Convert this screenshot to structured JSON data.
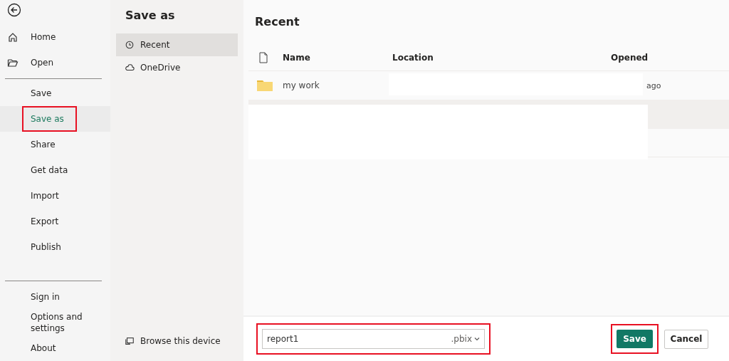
{
  "nav": {
    "groups": [
      {
        "items": [
          {
            "label": "Home",
            "kind": "home",
            "selected": false,
            "highlighted": false
          },
          {
            "label": "Open",
            "kind": "open",
            "selected": false,
            "highlighted": false
          }
        ]
      },
      {
        "items": [
          {
            "label": "Save",
            "selected": false,
            "highlighted": false
          },
          {
            "label": "Save as",
            "selected": true,
            "highlighted": true
          },
          {
            "label": "Share",
            "selected": false,
            "highlighted": false
          },
          {
            "label": "Get data",
            "selected": false,
            "highlighted": false
          },
          {
            "label": "Import",
            "selected": false,
            "highlighted": false
          },
          {
            "label": "Export",
            "selected": false,
            "highlighted": false
          },
          {
            "label": "Publish",
            "selected": false,
            "highlighted": false
          }
        ]
      },
      {
        "items": [
          {
            "label": "Sign in",
            "selected": false,
            "highlighted": false
          },
          {
            "label": "Options and settings",
            "selected": false,
            "highlighted": false
          },
          {
            "label": "About",
            "selected": false,
            "highlighted": false
          }
        ]
      }
    ]
  },
  "places": {
    "title": "Save as",
    "items": [
      {
        "label": "Recent",
        "kind": "recent",
        "selected": true
      },
      {
        "label": "OneDrive",
        "kind": "onedrive",
        "selected": false
      }
    ],
    "browse": "Browse this device"
  },
  "recent": {
    "title": "Recent",
    "columns": [
      "Name",
      "Location",
      "Opened"
    ],
    "rows": [
      {
        "name": "my work",
        "opened": "ago"
      }
    ]
  },
  "footer": {
    "filename": {
      "value": "report1",
      "extension": ".pbix",
      "highlighted": true
    },
    "save": {
      "label": "Save",
      "highlighted": true
    },
    "cancel": {
      "label": "Cancel"
    }
  }
}
